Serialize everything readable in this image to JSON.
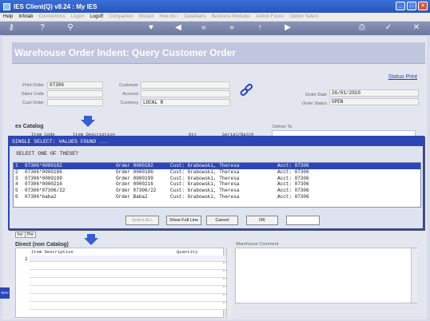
{
  "window": {
    "title": "IES Client(Q) v8.24 : My IES"
  },
  "menu": [
    "Help",
    "Infolab",
    "Connections",
    "Logon",
    "Logoff",
    "Companion",
    "Wizard",
    "How do I",
    "DataMarts",
    "Business Modules",
    "Action Focus",
    "Option Select"
  ],
  "menu_active": [
    true,
    true,
    false,
    false,
    true,
    false,
    false,
    false,
    false,
    false,
    false,
    false
  ],
  "toolbar_icons": [
    "key-icon",
    "help-icon",
    "search-icon",
    "heart-icon",
    "back-icon",
    "rewind-icon",
    "forward-icon",
    "up-icon",
    "next-icon",
    "print-icon",
    "ok-icon",
    "close-icon"
  ],
  "page_title": "Warehouse Order Indent: Query Customer Order",
  "status_print": "Status Print",
  "form": {
    "print_order_label": "Print Order",
    "print_order_value": "07306",
    "sales_code_label": "Sales Code",
    "sales_code_value": "",
    "cust_order_label": "Cust Order",
    "cust_order_value": "",
    "customer_label": "Customer",
    "customer_value": "",
    "account_label": "Account",
    "account_value": "",
    "currency_label": "Currency",
    "currency_value": "LOCAL R",
    "order_date_label": "Order Date",
    "order_date_value": "26/01/2010",
    "order_status_label": "Order Status",
    "order_status_value": "OPEN"
  },
  "catalog_label": "ex Catalog",
  "catalog_headers": [
    "Item Code",
    "Item Description",
    "Qty",
    "Serial/Batch"
  ],
  "deliver_to_label": "Deliver To",
  "dialog": {
    "title": "SINGLE SELECT: VALUES FOUND ...",
    "prompt": "SELECT ONE OF THESE?",
    "rows": [
      {
        "n": "1",
        "code": "07306*0000182",
        "order": "Order 0000182",
        "cust": "Cust: Grabowski, Theresa",
        "acct": "Acct: 07306"
      },
      {
        "n": "2",
        "code": "07306*0000186",
        "order": "Order 0000186",
        "cust": "Cust: Grabowski, Theresa",
        "acct": "Acct: 07306"
      },
      {
        "n": "3",
        "code": "07306*0000199",
        "order": "Order 0000199",
        "cust": "Cust: Grabowski, Theresa",
        "acct": "Acct: 07306"
      },
      {
        "n": "4",
        "code": "07306*0000216",
        "order": "Order 0000216",
        "cust": "Cust: Grabowski, Theresa",
        "acct": "Acct: 07306"
      },
      {
        "n": "5",
        "code": "07306*07306/22",
        "order": "Order 07306/22",
        "cust": "Cust: Grabowski, Theresa",
        "acct": "Acct: 07306"
      },
      {
        "n": "6",
        "code": "07306*baba2",
        "order": "Order Baba2",
        "cust": "Cust: Grabowski, Theresa",
        "acct": "Acct: 07306"
      }
    ],
    "buttons": {
      "select_all": "Select ALL",
      "show_full_line": "Show Full Line",
      "cancel": "Cancel",
      "ok": "OK"
    }
  },
  "mini_tabs": [
    "Inv",
    "Pre"
  ],
  "direct_label": "Direct (non Catalog)",
  "direct_headers": {
    "item_description": "Item Description",
    "quantity": "Quantity"
  },
  "direct_first_row": "1",
  "warehouse_comment_label": "Warehouse Comment",
  "side_strip": "Serv"
}
